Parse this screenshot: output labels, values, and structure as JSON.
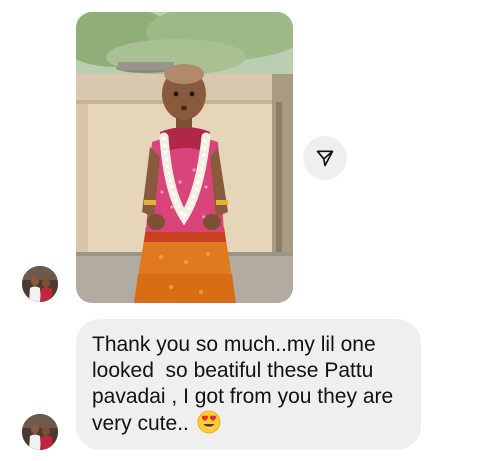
{
  "thread": {
    "photo_message": {
      "image_alt": "child in orange pattu pavadai with jasmine garland",
      "share_icon": "send-paper-plane-icon"
    },
    "text_message": {
      "lines": [
        "Thank you so much..my lil one",
        "looked  so beatiful these Pattu",
        "pavadai , I got from you they are",
        "very cute.. "
      ],
      "emoji": "smiling-face-with-heart-eyes-emoji"
    },
    "avatar_icon": "profile-avatar"
  },
  "colors": {
    "bubble_bg": "#efefef",
    "text": "#121212",
    "background": "#ffffff"
  }
}
